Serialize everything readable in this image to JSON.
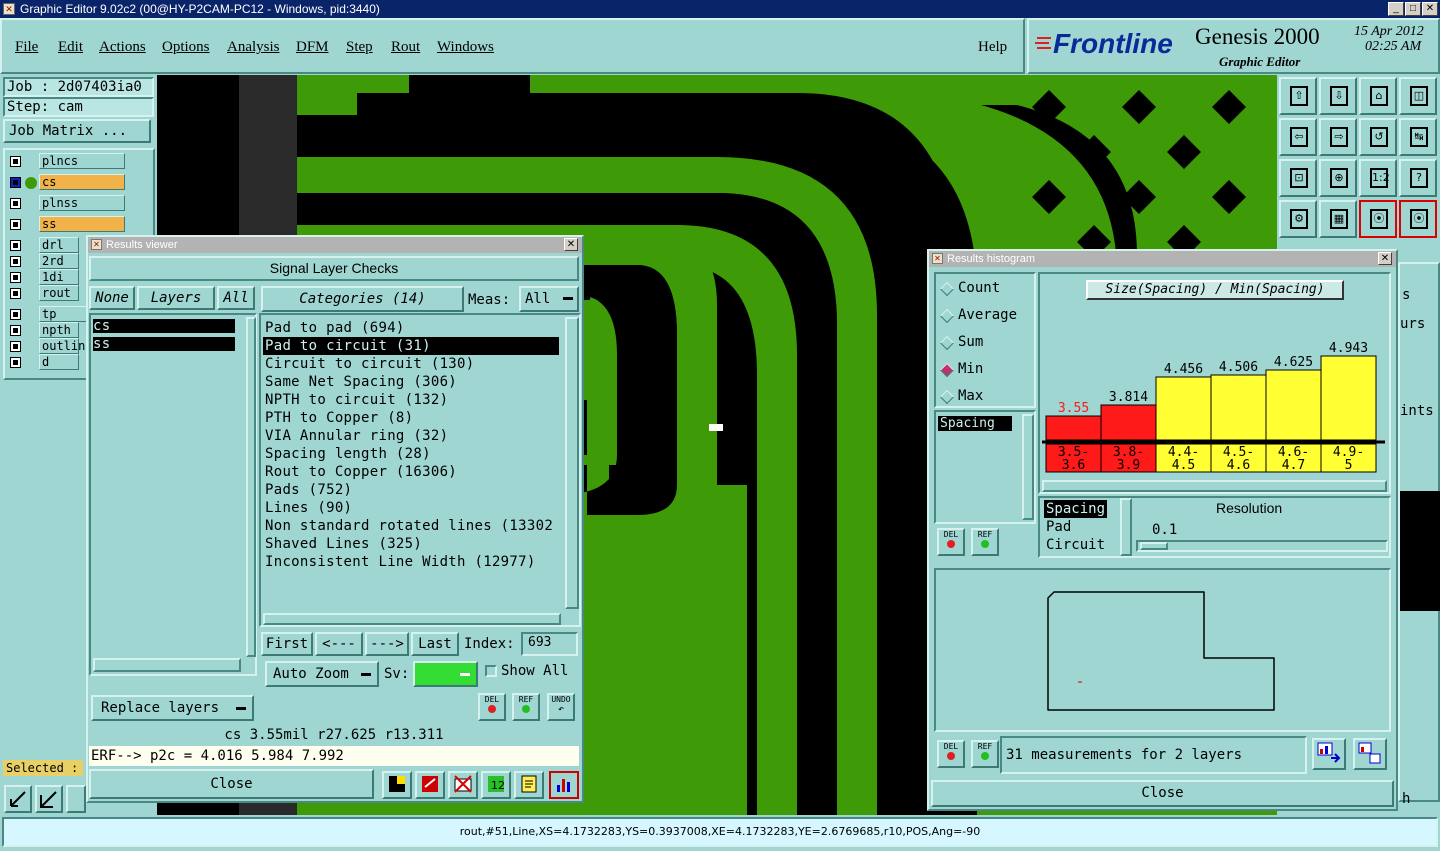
{
  "window": {
    "title": "Graphic Editor 9.02c2 (00@HY-P2CAM-PC12 - Windows, pid:3440)"
  },
  "menu": {
    "items": [
      "File",
      "Edit",
      "Actions",
      "Options",
      "Analysis",
      "DFM",
      "Step",
      "Rout",
      "Windows"
    ],
    "help": "Help"
  },
  "brand": {
    "logo": "Frontline",
    "product": "Genesis 2000",
    "subtitle": "Graphic Editor",
    "date": "15 Apr 2012",
    "time": "02:25 AM"
  },
  "job": {
    "job_label": "Job : 2d07403ia0",
    "step_label": "Step: cam",
    "matrix_button": "Job Matrix ..."
  },
  "layers": [
    {
      "name": "plncs"
    },
    {
      "name": "cs"
    },
    {
      "name": "plnss"
    },
    {
      "name": "ss"
    },
    {
      "name": "drl"
    },
    {
      "name": "2rd"
    },
    {
      "name": "1di"
    },
    {
      "name": "rout"
    },
    {
      "name": "tp"
    },
    {
      "name": "npth"
    },
    {
      "name": "outlin"
    },
    {
      "name": "d"
    }
  ],
  "selected_label": "Selected :",
  "toolbar_tiles": [
    "⇧",
    "⇩",
    "⌂",
    "◫",
    "⇦",
    "⇨",
    "↺",
    "↹",
    "⊡",
    "⊕",
    "1:2",
    "?",
    "⚙",
    "▦",
    "⦿",
    "⦿"
  ],
  "results_viewer": {
    "title": "Results viewer",
    "header": "Signal Layer Checks",
    "none_btn": "None",
    "layers_btn": "Layers",
    "all_btn": "All",
    "categories_btn": "Categories (14)",
    "meas_label": "Meas:",
    "meas_value": "All",
    "layer_list": [
      "cs",
      "ss"
    ],
    "categories": [
      "Pad to pad (694)",
      "Pad to circuit (31)",
      "Circuit to circuit (130)",
      "Same Net Spacing (306)",
      "NPTH to circuit (132)",
      "PTH to Copper (8)",
      "VIA Annular ring (32)",
      "Spacing length (28)",
      "Rout to Copper (16306)",
      "Pads (752)",
      "Lines (90)",
      "Non standard rotated lines (13302",
      "Shaved Lines (325)",
      "Inconsistent Line Width (12977)"
    ],
    "selected_category_index": 1,
    "nav": {
      "first": "First",
      "prev": "<---",
      "next": "--->",
      "last": "Last",
      "index_label": "Index:",
      "index_value": "693"
    },
    "auto_zoom": "Auto Zoom",
    "sv_label": "Sv:",
    "show_all": "Show All",
    "replace_layers": "Replace layers",
    "btn_del": "DEL",
    "btn_ref": "REF",
    "btn_undo": "UNDO",
    "status": "cs 3.55mil  r27.625  r13.311",
    "erf": "ERF--> p2c = 4.016 5.984 7.992",
    "close": "Close"
  },
  "histogram": {
    "title": "Results histogram",
    "modes": [
      "Count",
      "Average",
      "Sum",
      "Min",
      "Max"
    ],
    "selected_mode": "Min",
    "list_item": "Spacing",
    "chart_title": "Size(Spacing) / Min(Spacing)",
    "btn_del": "DEL",
    "btn_ref": "REF",
    "measure_list": [
      "Spacing",
      "Pad",
      "Circuit"
    ],
    "resolution_label": "Resolution",
    "resolution_value": "0.1",
    "summary": "31 measurements for 2 layers",
    "close": "Close"
  },
  "chart_data": {
    "type": "bar",
    "title": "Size(Spacing) / Min(Spacing)",
    "categories": [
      "3.5-3.6",
      "3.8-3.9",
      "4.4-4.5",
      "4.5-4.6",
      "4.6-4.7",
      "4.9-5"
    ],
    "category_lines": [
      [
        "3.5-",
        "3.6"
      ],
      [
        "3.8-",
        "3.9"
      ],
      [
        "4.4-",
        "4.5"
      ],
      [
        "4.5-",
        "4.6"
      ],
      [
        "4.6-",
        "4.7"
      ],
      [
        "4.9-",
        "5"
      ]
    ],
    "values": [
      3.55,
      3.814,
      4.456,
      4.506,
      4.625,
      4.943
    ],
    "value_labels": [
      "3.55",
      "3.814",
      "4.456",
      "4.506",
      "4.625",
      "4.943"
    ],
    "colors": [
      "#ff1a1a",
      "#ff1a1a",
      "#ffff33",
      "#ffff33",
      "#ffff33",
      "#ffff33"
    ],
    "label_colors": [
      "#ff1a1a",
      "#000000",
      "#000000",
      "#000000",
      "#000000",
      "#000000"
    ]
  },
  "status_bar": "rout,#51,Line,XS=4.1732283,YS=0.3937008,XE=4.1732283,YE=2.6769685,r10,POS,Ang=-90",
  "right_fragments": [
    "s",
    "urs",
    "ints",
    "h"
  ],
  "colors": {
    "panel": "#9fd6d2",
    "copper": "#3f9a08",
    "canvas": "#000000",
    "selected_row": "#000000"
  }
}
